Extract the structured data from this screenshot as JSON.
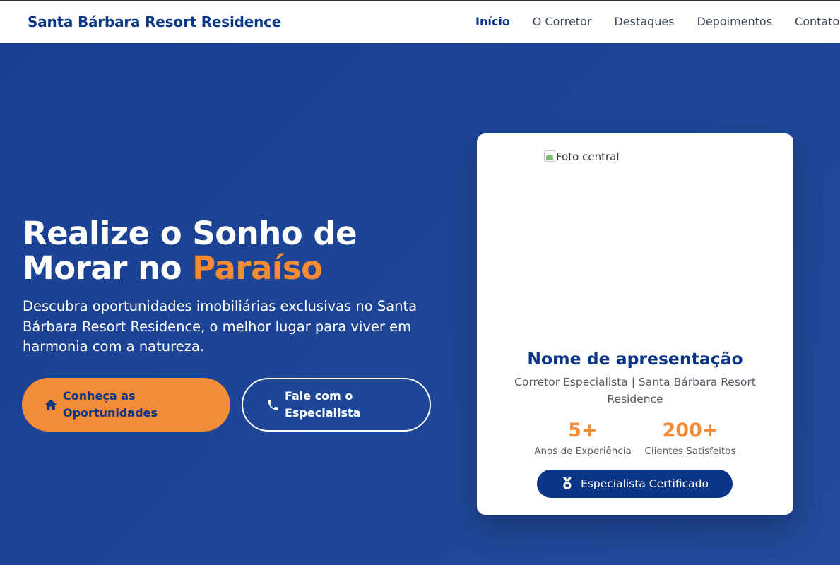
{
  "header": {
    "brand": "Santa Bárbara Resort Residence",
    "nav": [
      {
        "label": "Início",
        "active": true
      },
      {
        "label": "O Corretor",
        "active": false
      },
      {
        "label": "Destaques",
        "active": false
      },
      {
        "label": "Depoimentos",
        "active": false
      },
      {
        "label": "Contato",
        "active": false
      }
    ]
  },
  "hero": {
    "title_line1": "Realize o Sonho de",
    "title_line2_prefix": "Morar no ",
    "title_accent": "Paraíso",
    "description": "Descubra oportunidades imobiliárias exclusivas no Santa Bárbara Resort Residence, o melhor lugar para viver em harmonia com a natureza.",
    "primary_button": {
      "label": "Conheça as Oportunidades",
      "icon": "home-icon"
    },
    "secondary_button": {
      "label": "Fale com o Especialista",
      "icon": "phone-icon"
    }
  },
  "card": {
    "photo_alt": "Foto central",
    "name": "Nome de apresentação",
    "role": "Corretor Especialista | Santa Bárbara Resort Residence",
    "stats": [
      {
        "value": "5+",
        "label": "Anos de Experiência"
      },
      {
        "value": "200+",
        "label": "Clientes Satisfeitos"
      }
    ],
    "badge": {
      "label": "Especialista Certificado",
      "icon": "medal-icon"
    }
  },
  "colors": {
    "primary": "#0a3687",
    "hero_bg": "#1e4594",
    "accent": "#f28c38",
    "white": "#ffffff"
  }
}
